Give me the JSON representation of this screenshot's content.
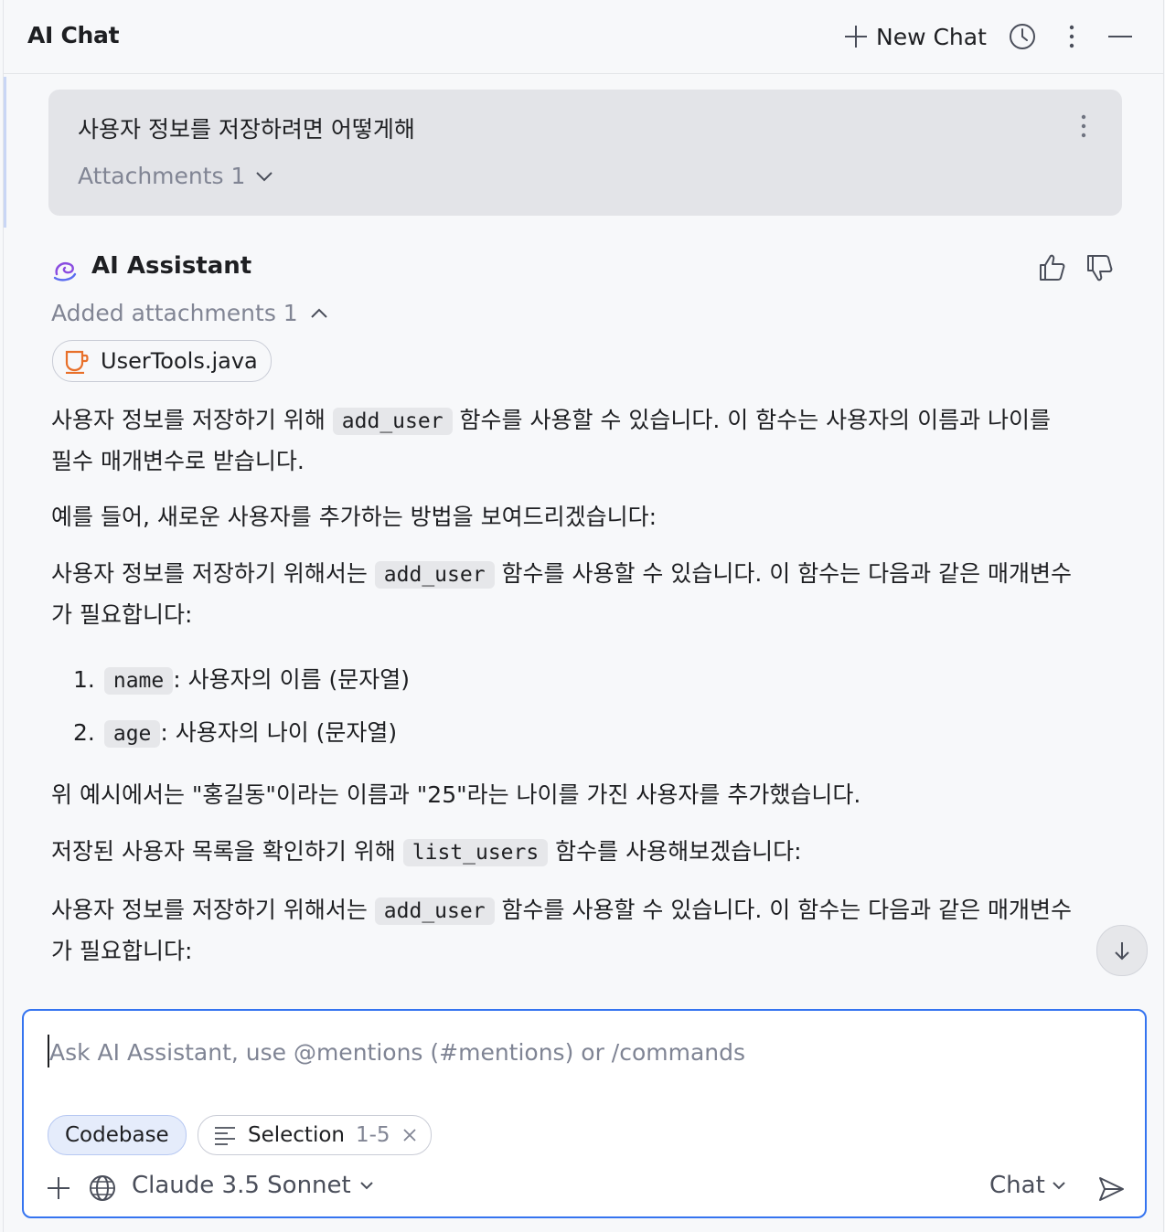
{
  "header": {
    "title": "AI Chat",
    "new_chat_label": "New Chat"
  },
  "user_message": {
    "text": "사용자 정보를 저장하려면 어떻게해",
    "attachments_label": "Attachments 1"
  },
  "assistant": {
    "name": "AI Assistant",
    "added_attachments_label": "Added attachments 1",
    "attachment_file": "UserTools.java",
    "paragraphs": {
      "p1_a": "사용자 정보를 저장하기 위해 ",
      "p1_code": "add_user",
      "p1_b": " 함수를 사용할 수 있습니다. 이 함수는 사용자의 이름과 나이를",
      "p1_c": "필수 매개변수로 받습니다.",
      "p2": "예를 들어, 새로운 사용자를 추가하는 방법을 보여드리겠습니다:",
      "p3_a": "사용자 정보를 저장하기 위해서는 ",
      "p3_code": "add_user",
      "p3_b": " 함수를 사용할 수 있습니다. 이 함수는 다음과 같은 매개변수",
      "p3_c": "가 필요합니다:",
      "list": [
        {
          "num": "1.",
          "code": "name",
          "text": ": 사용자의 이름 (문자열)"
        },
        {
          "num": "2.",
          "code": "age",
          "text": ": 사용자의 나이 (문자열)"
        }
      ],
      "p4": "위 예시에서는 \"홍길동\"이라는 이름과 \"25\"라는 나이를 가진 사용자를 추가했습니다.",
      "p5_a": "저장된 사용자 목록을 확인하기 위해 ",
      "p5_code": "list_users",
      "p5_b": " 함수를 사용해보겠습니다:",
      "p6_a": "사용자 정보를 저장하기 위해서는 ",
      "p6_code": "add_user",
      "p6_b": " 함수를 사용할 수 있습니다. 이 함수는 다음과 같은 매개변수",
      "p6_c": "가 필요합니다:"
    }
  },
  "input": {
    "placeholder": "Ask AI Assistant, use @mentions (#mentions) or /commands",
    "value": "",
    "chip_codebase": "Codebase",
    "chip_selection_label": "Selection",
    "chip_selection_range": "1-5",
    "model": "Claude 3.5 Sonnet",
    "mode": "Chat"
  },
  "colors": {
    "accent": "#3574f0",
    "ai_logo": "#8a4ce0",
    "java_icon": "#e8702a"
  }
}
